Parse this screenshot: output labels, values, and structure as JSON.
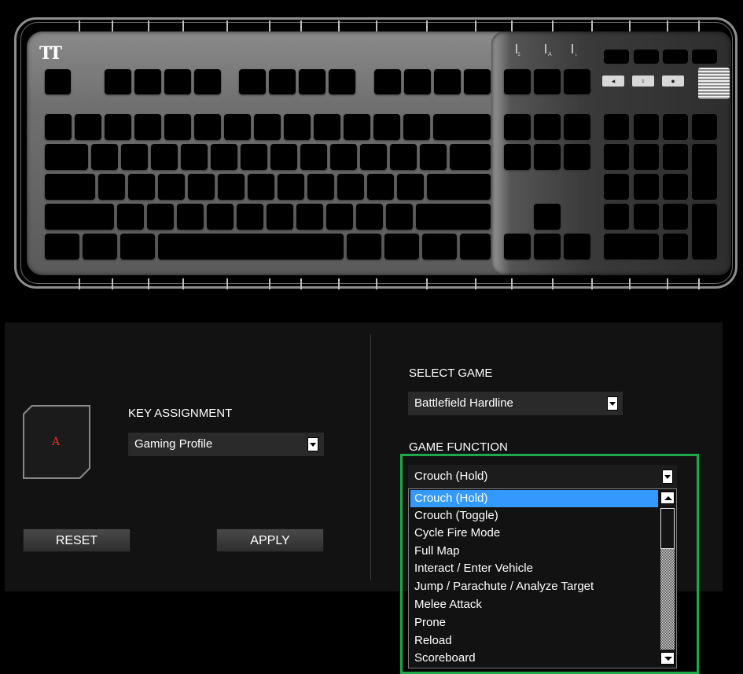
{
  "brand": {
    "logo_text": "TT"
  },
  "keyboard": {
    "lock_labels": [
      "1",
      "A",
      "↓"
    ],
    "media_buttons": [
      "◂",
      "♀",
      "●"
    ],
    "selected_key": "A"
  },
  "key_assignment": {
    "label": "KEY ASSIGNMENT",
    "value": "Gaming Profile"
  },
  "buttons": {
    "reset": "RESET",
    "apply": "APPLY"
  },
  "select_game": {
    "label": "SELECT GAME",
    "value": "Battlefield Hardline"
  },
  "game_function": {
    "label": "GAME FUNCTION",
    "value": "Crouch (Hold)",
    "options": [
      "Crouch (Hold)",
      "Crouch (Toggle)",
      "Cycle Fire Mode",
      "Full Map",
      "Interact / Enter Vehicle",
      "Jump / Parachute / Analyze Target",
      "Melee Attack",
      "Prone",
      "Reload",
      "Scoreboard"
    ],
    "highlighted_index": 0
  },
  "colors": {
    "highlight": "#3399ff",
    "focus_outline": "#1ea84a",
    "key_letter": "#e0302f"
  }
}
